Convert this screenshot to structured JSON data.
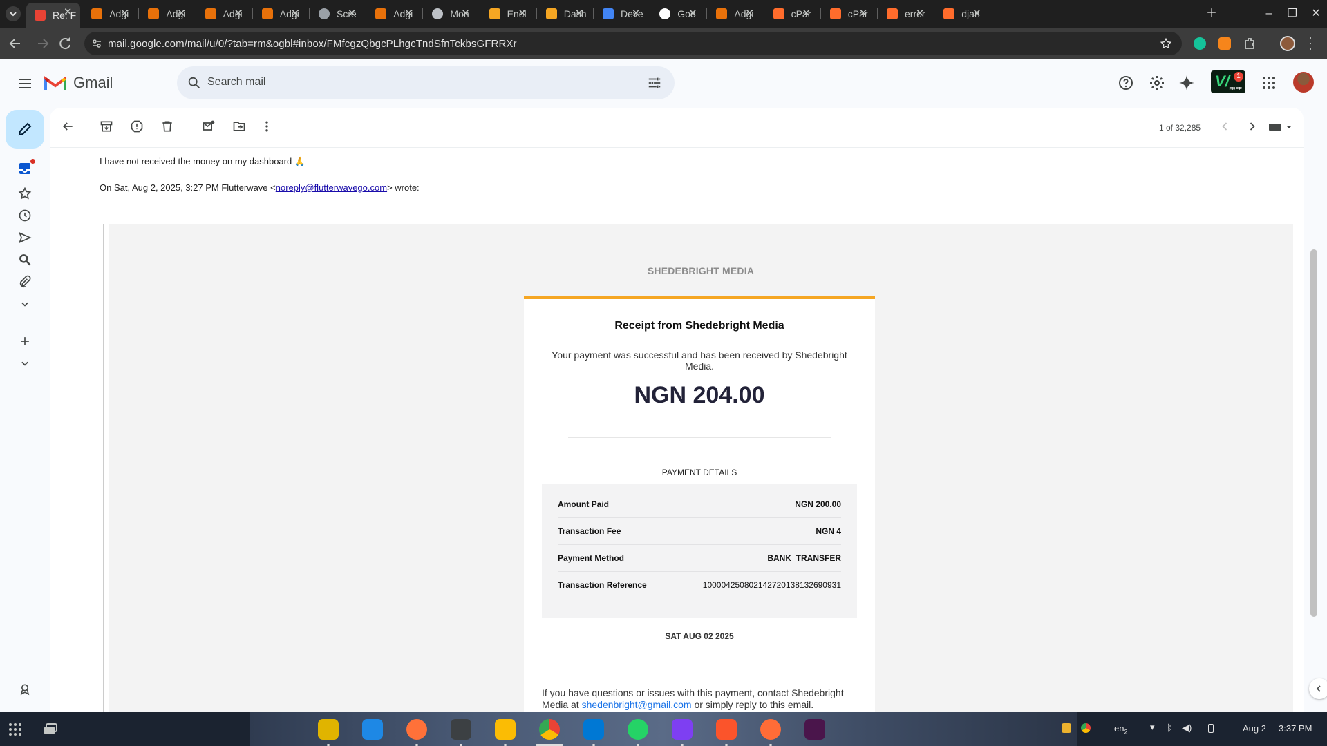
{
  "browser": {
    "tabs": [
      {
        "title": "Re: F",
        "icon": "gmail-icon",
        "active": true
      },
      {
        "title": "Adgi",
        "icon": "adgi-icon"
      },
      {
        "title": "Adgi",
        "icon": "adgi-icon"
      },
      {
        "title": "Adgi",
        "icon": "adgi-icon"
      },
      {
        "title": "Adgi",
        "icon": "adgi-icon"
      },
      {
        "title": "Scre",
        "icon": "globe-icon"
      },
      {
        "title": "Adgi",
        "icon": "adgi-icon"
      },
      {
        "title": "Mon",
        "icon": "web-icon"
      },
      {
        "title": "Endl",
        "icon": "flutterwave-icon"
      },
      {
        "title": "Dash",
        "icon": "flutterwave-icon"
      },
      {
        "title": "Deve",
        "icon": "docs-icon"
      },
      {
        "title": "Goo",
        "icon": "google-icon"
      },
      {
        "title": "Adgi",
        "icon": "adgi-icon"
      },
      {
        "title": "cPar",
        "icon": "cpanel-icon"
      },
      {
        "title": "cPar",
        "icon": "cpanel-icon"
      },
      {
        "title": "error",
        "icon": "cpanel-icon"
      },
      {
        "title": "djan",
        "icon": "cpanel-icon"
      }
    ],
    "url": "mail.google.com/mail/u/0/?tab=rm&ogbl#inbox/FMfcgzQbgcPLhgcTndSfnTckbsGFRRXr"
  },
  "gmail": {
    "logo_text": "Gmail",
    "search_placeholder": "Search mail",
    "extension_badge": "1",
    "extension_label": "FREE",
    "counter": "1 of 32,285"
  },
  "message": {
    "body": "I have not received the money on my dashboard 🙏",
    "quote_prefix": "On Sat, Aug 2, 2025, 3:27 PM Flutterwave <",
    "quote_email": "noreply@flutterwavego.com",
    "quote_suffix": "> wrote:"
  },
  "receipt": {
    "brand": "SHEDEBRIGHT MEDIA",
    "title": "Receipt from Shedebright Media",
    "subtitle": "Your payment was successful and has been received by Shedebright Media.",
    "amount": "NGN 204.00",
    "details_heading": "PAYMENT DETAILS",
    "details": [
      {
        "label": "Amount Paid",
        "value": "NGN 200.00"
      },
      {
        "label": "Transaction Fee",
        "value": "NGN 4"
      },
      {
        "label": "Payment Method",
        "value": "BANK_TRANSFER"
      },
      {
        "label": "Transaction Reference",
        "value": "100004250802142720138132690931"
      }
    ],
    "date": "SAT AUG 02 2025",
    "contact_prefix": "If you have questions or issues with this payment, contact Shedebright Media at ",
    "contact_email": "shedenbright@gmail.com",
    "contact_suffix": " or simply reply to this email."
  },
  "taskbar": {
    "lang": "en",
    "lang_sub": "2",
    "date": "Aug 2",
    "time": "3:37 PM"
  },
  "colors": {
    "accent_orange": "#f5a623",
    "gmail_red": "#ea4335",
    "compose_bg": "#c2e7ff",
    "link_blue": "#1a73e8"
  }
}
